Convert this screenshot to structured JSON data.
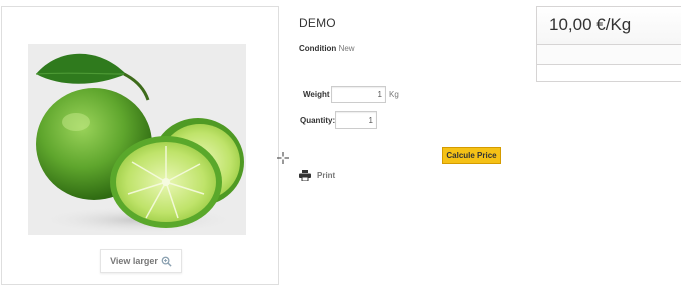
{
  "product": {
    "title": "DEMO",
    "condition_label": "Condition",
    "condition_value": "New",
    "image_alt": "Limes",
    "view_larger_label": "View larger",
    "view_larger_icon": "zoom-in-icon"
  },
  "form": {
    "weight_label": "Weight",
    "weight_value": "1",
    "weight_unit": "Kg",
    "quantity_label": "Quantity:",
    "quantity_value": "1",
    "calculate_label": "Calcule Price"
  },
  "actions": {
    "print_label": "Print",
    "print_icon": "printer-icon"
  },
  "price": {
    "display": "10,00 €/Kg"
  },
  "colors": {
    "button_yellow": "#f5c116",
    "border_gray": "#dedede",
    "lime_green": "#6db33f"
  }
}
